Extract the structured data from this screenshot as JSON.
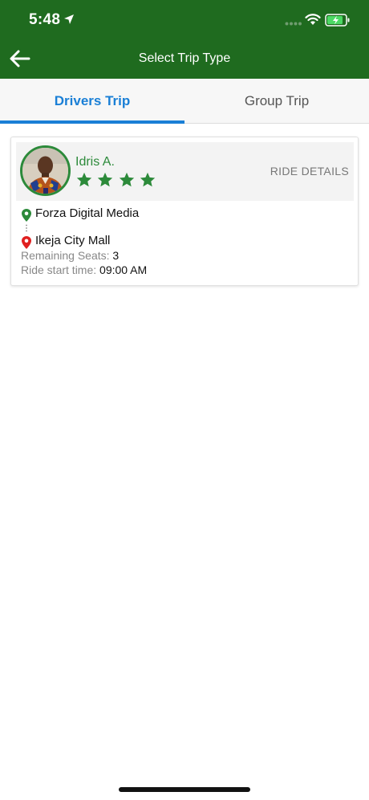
{
  "status_bar": {
    "time": "5:48"
  },
  "nav": {
    "title": "Select Trip Type",
    "back_icon": "arrow-left-icon"
  },
  "tabs": [
    {
      "label": "Drivers Trip",
      "active": true
    },
    {
      "label": "Group Trip",
      "active": false
    }
  ],
  "trip": {
    "driver_name": "Idris A.",
    "rating": 4,
    "ride_details_label": "RIDE DETAILS",
    "from": "Forza Digital Media",
    "to": "Ikeja City Mall",
    "remaining_seats_label": "Remaining Seats:",
    "remaining_seats": "3",
    "start_time_label": "Ride start time:",
    "start_time": "09:00 AM"
  },
  "colors": {
    "header": "#1f6b1f",
    "tab_active": "#1a7fd6",
    "driver_green": "#2c8a3a",
    "pin_green": "#2c8a3a",
    "pin_red": "#e02020"
  }
}
